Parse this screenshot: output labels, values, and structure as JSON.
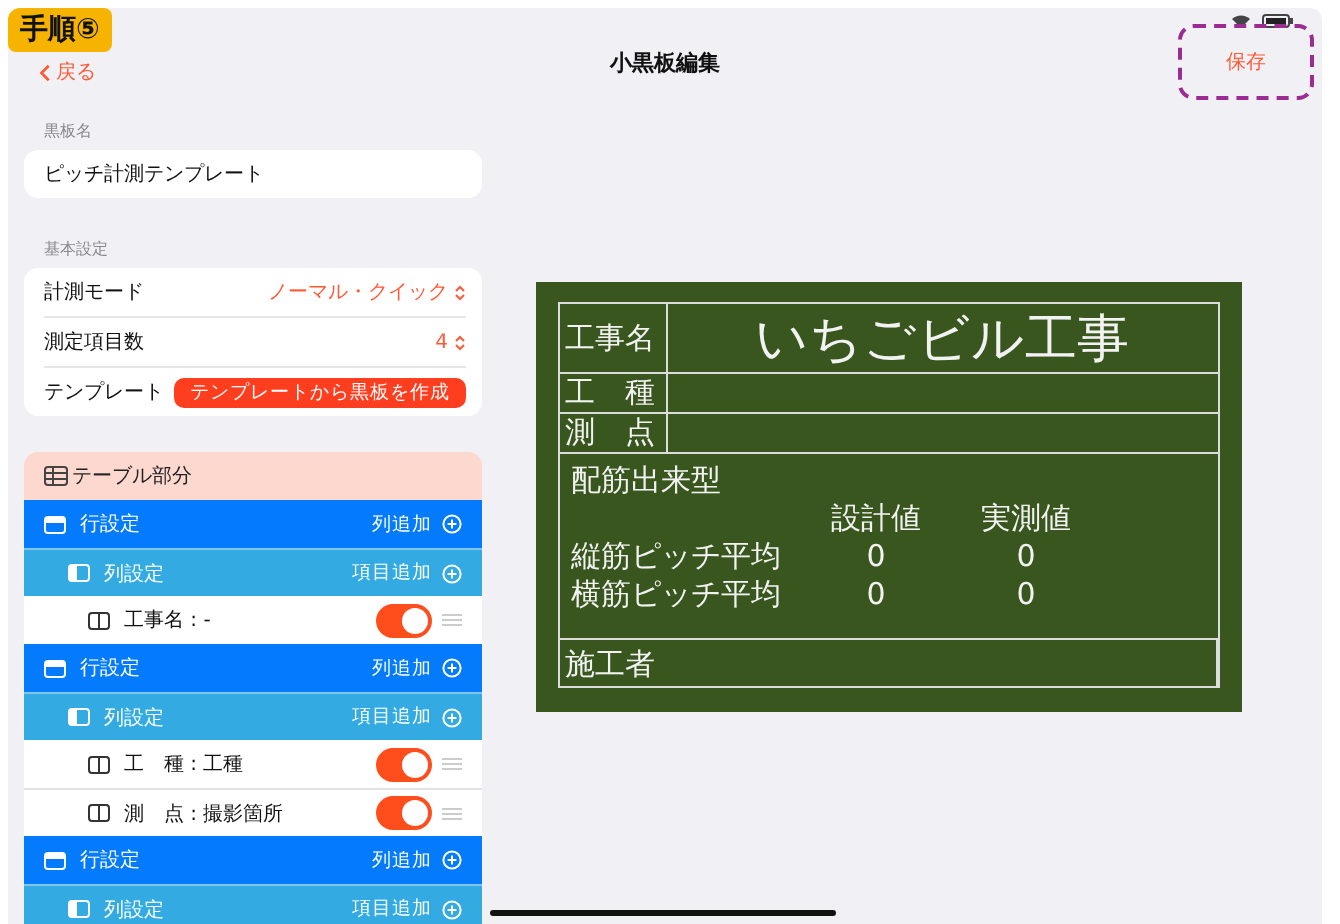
{
  "badge": "手順⑤",
  "nav": {
    "back": "戻る",
    "title": "小黒板編集",
    "save": {
      "label": "保存",
      "highlighted": true
    }
  },
  "name_section": {
    "label": "黒板名",
    "value": "ピッチ計測テンプレート"
  },
  "basic": {
    "label": "基本設定",
    "rows": [
      {
        "kind": "picker",
        "label": "計測モード",
        "value": "ノーマル・クイック"
      },
      {
        "kind": "picker",
        "label": "測定項目数",
        "value": "4"
      },
      {
        "kind": "button",
        "label": "テンプレート",
        "value": "テンプレートから黒板を作成"
      }
    ]
  },
  "table": {
    "title": "テーブル部分",
    "rows": [
      {
        "kind": "row",
        "label": "行設定",
        "action": "列追加"
      },
      {
        "kind": "column",
        "label": "列設定",
        "action": "項目追加"
      },
      {
        "kind": "item",
        "label": "工事名 : -",
        "on": true
      },
      {
        "kind": "row",
        "label": "行設定",
        "action": "列追加"
      },
      {
        "kind": "column",
        "label": "列設定",
        "action": "項目追加"
      },
      {
        "kind": "item",
        "label": "工　種 : 工種",
        "on": true
      },
      {
        "kind": "item",
        "label": "測　点 : 撮影箇所",
        "on": true
      },
      {
        "kind": "row",
        "label": "行設定",
        "action": "列追加"
      },
      {
        "kind": "column",
        "label": "列設定",
        "action": "項目追加"
      }
    ]
  },
  "board": {
    "title_label": "工事名",
    "title_value": "いちごビル工事",
    "rows": [
      {
        "label": "工　種"
      },
      {
        "label": "測　点"
      }
    ],
    "body": {
      "heading": "配筋出来型",
      "columns": [
        "設計値",
        "実測値"
      ],
      "rows": [
        {
          "label": "縦筋ピッチ平均",
          "values": [
            "0",
            "0"
          ]
        },
        {
          "label": "横筋ピッチ平均",
          "values": [
            "0",
            "0"
          ]
        }
      ]
    },
    "footer_label": "施工者"
  }
}
